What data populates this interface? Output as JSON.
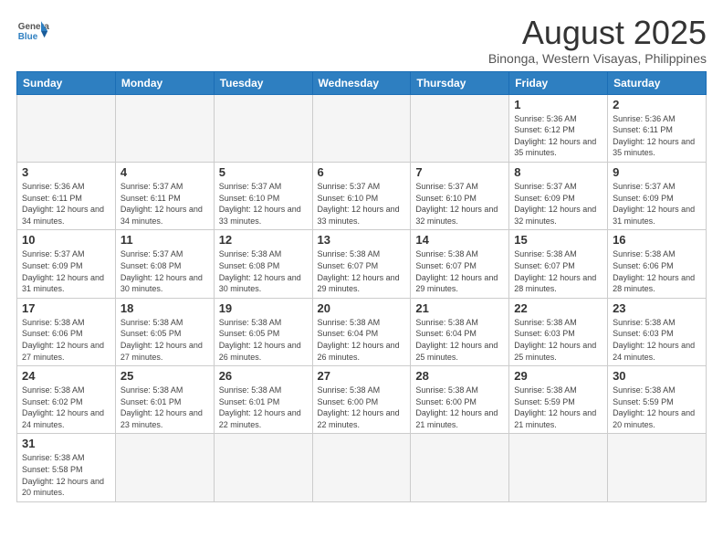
{
  "header": {
    "logo_general": "General",
    "logo_blue": "Blue",
    "title": "August 2025",
    "subtitle": "Binonga, Western Visayas, Philippines"
  },
  "weekdays": [
    "Sunday",
    "Monday",
    "Tuesday",
    "Wednesday",
    "Thursday",
    "Friday",
    "Saturday"
  ],
  "weeks": [
    [
      {
        "day": "",
        "info": ""
      },
      {
        "day": "",
        "info": ""
      },
      {
        "day": "",
        "info": ""
      },
      {
        "day": "",
        "info": ""
      },
      {
        "day": "",
        "info": ""
      },
      {
        "day": "1",
        "info": "Sunrise: 5:36 AM\nSunset: 6:12 PM\nDaylight: 12 hours\nand 35 minutes."
      },
      {
        "day": "2",
        "info": "Sunrise: 5:36 AM\nSunset: 6:11 PM\nDaylight: 12 hours\nand 35 minutes."
      }
    ],
    [
      {
        "day": "3",
        "info": "Sunrise: 5:36 AM\nSunset: 6:11 PM\nDaylight: 12 hours\nand 34 minutes."
      },
      {
        "day": "4",
        "info": "Sunrise: 5:37 AM\nSunset: 6:11 PM\nDaylight: 12 hours\nand 34 minutes."
      },
      {
        "day": "5",
        "info": "Sunrise: 5:37 AM\nSunset: 6:10 PM\nDaylight: 12 hours\nand 33 minutes."
      },
      {
        "day": "6",
        "info": "Sunrise: 5:37 AM\nSunset: 6:10 PM\nDaylight: 12 hours\nand 33 minutes."
      },
      {
        "day": "7",
        "info": "Sunrise: 5:37 AM\nSunset: 6:10 PM\nDaylight: 12 hours\nand 32 minutes."
      },
      {
        "day": "8",
        "info": "Sunrise: 5:37 AM\nSunset: 6:09 PM\nDaylight: 12 hours\nand 32 minutes."
      },
      {
        "day": "9",
        "info": "Sunrise: 5:37 AM\nSunset: 6:09 PM\nDaylight: 12 hours\nand 31 minutes."
      }
    ],
    [
      {
        "day": "10",
        "info": "Sunrise: 5:37 AM\nSunset: 6:09 PM\nDaylight: 12 hours\nand 31 minutes."
      },
      {
        "day": "11",
        "info": "Sunrise: 5:37 AM\nSunset: 6:08 PM\nDaylight: 12 hours\nand 30 minutes."
      },
      {
        "day": "12",
        "info": "Sunrise: 5:38 AM\nSunset: 6:08 PM\nDaylight: 12 hours\nand 30 minutes."
      },
      {
        "day": "13",
        "info": "Sunrise: 5:38 AM\nSunset: 6:07 PM\nDaylight: 12 hours\nand 29 minutes."
      },
      {
        "day": "14",
        "info": "Sunrise: 5:38 AM\nSunset: 6:07 PM\nDaylight: 12 hours\nand 29 minutes."
      },
      {
        "day": "15",
        "info": "Sunrise: 5:38 AM\nSunset: 6:07 PM\nDaylight: 12 hours\nand 28 minutes."
      },
      {
        "day": "16",
        "info": "Sunrise: 5:38 AM\nSunset: 6:06 PM\nDaylight: 12 hours\nand 28 minutes."
      }
    ],
    [
      {
        "day": "17",
        "info": "Sunrise: 5:38 AM\nSunset: 6:06 PM\nDaylight: 12 hours\nand 27 minutes."
      },
      {
        "day": "18",
        "info": "Sunrise: 5:38 AM\nSunset: 6:05 PM\nDaylight: 12 hours\nand 27 minutes."
      },
      {
        "day": "19",
        "info": "Sunrise: 5:38 AM\nSunset: 6:05 PM\nDaylight: 12 hours\nand 26 minutes."
      },
      {
        "day": "20",
        "info": "Sunrise: 5:38 AM\nSunset: 6:04 PM\nDaylight: 12 hours\nand 26 minutes."
      },
      {
        "day": "21",
        "info": "Sunrise: 5:38 AM\nSunset: 6:04 PM\nDaylight: 12 hours\nand 25 minutes."
      },
      {
        "day": "22",
        "info": "Sunrise: 5:38 AM\nSunset: 6:03 PM\nDaylight: 12 hours\nand 25 minutes."
      },
      {
        "day": "23",
        "info": "Sunrise: 5:38 AM\nSunset: 6:03 PM\nDaylight: 12 hours\nand 24 minutes."
      }
    ],
    [
      {
        "day": "24",
        "info": "Sunrise: 5:38 AM\nSunset: 6:02 PM\nDaylight: 12 hours\nand 24 minutes."
      },
      {
        "day": "25",
        "info": "Sunrise: 5:38 AM\nSunset: 6:01 PM\nDaylight: 12 hours\nand 23 minutes."
      },
      {
        "day": "26",
        "info": "Sunrise: 5:38 AM\nSunset: 6:01 PM\nDaylight: 12 hours\nand 22 minutes."
      },
      {
        "day": "27",
        "info": "Sunrise: 5:38 AM\nSunset: 6:00 PM\nDaylight: 12 hours\nand 22 minutes."
      },
      {
        "day": "28",
        "info": "Sunrise: 5:38 AM\nSunset: 6:00 PM\nDaylight: 12 hours\nand 21 minutes."
      },
      {
        "day": "29",
        "info": "Sunrise: 5:38 AM\nSunset: 5:59 PM\nDaylight: 12 hours\nand 21 minutes."
      },
      {
        "day": "30",
        "info": "Sunrise: 5:38 AM\nSunset: 5:59 PM\nDaylight: 12 hours\nand 20 minutes."
      }
    ],
    [
      {
        "day": "31",
        "info": "Sunrise: 5:38 AM\nSunset: 5:58 PM\nDaylight: 12 hours\nand 20 minutes."
      },
      {
        "day": "",
        "info": ""
      },
      {
        "day": "",
        "info": ""
      },
      {
        "day": "",
        "info": ""
      },
      {
        "day": "",
        "info": ""
      },
      {
        "day": "",
        "info": ""
      },
      {
        "day": "",
        "info": ""
      }
    ]
  ]
}
